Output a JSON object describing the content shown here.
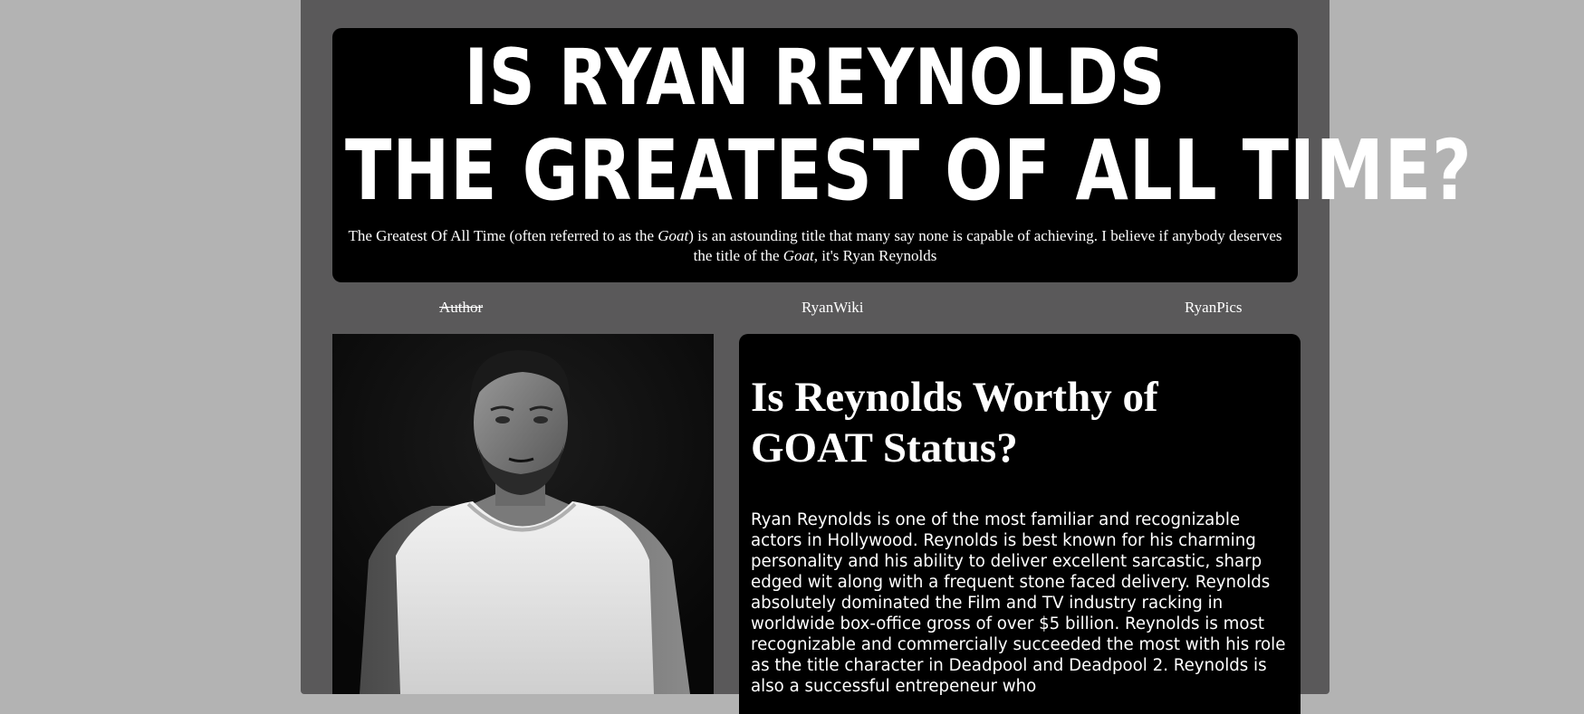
{
  "banner": {
    "title_line1": "IS RYAN REYNOLDS",
    "title_line2": "THE GREATEST OF ALL TIME?",
    "desc_part1": "The Greatest Of All Time (often referred to as the ",
    "desc_goat1": "Goat",
    "desc_part2": ") is an astounding title that many say none is capable of achieving. I believe if anybody deserves the title of the ",
    "desc_goat2": "Goat",
    "desc_part3": ", it's Ryan Reynolds"
  },
  "nav": {
    "author": "Author",
    "wiki": "RyanWiki",
    "pics": "RyanPics"
  },
  "article": {
    "heading": "Is Reynolds Worthy of GOAT Status?",
    "body": "Ryan Reynolds is one of the most familiar and recognizable actors in Hollywood. Reynolds is best known for his charming personality and his ability to deliver excellent sarcastic, sharp edged wit along with a frequent stone faced delivery. Reynolds absolutely dominated the Film and TV industry racking in worldwide box-office gross of over $5 billion. Reynolds is most recognizable and commercially succeeded the most with his role as the title character in Deadpool and Deadpool 2. Reynolds is also a successful entrepeneur who"
  },
  "colors": {
    "page_bg": "#b3b3b3",
    "container_bg": "#5a595a",
    "panel_bg": "#000000",
    "text": "#ffffff"
  }
}
